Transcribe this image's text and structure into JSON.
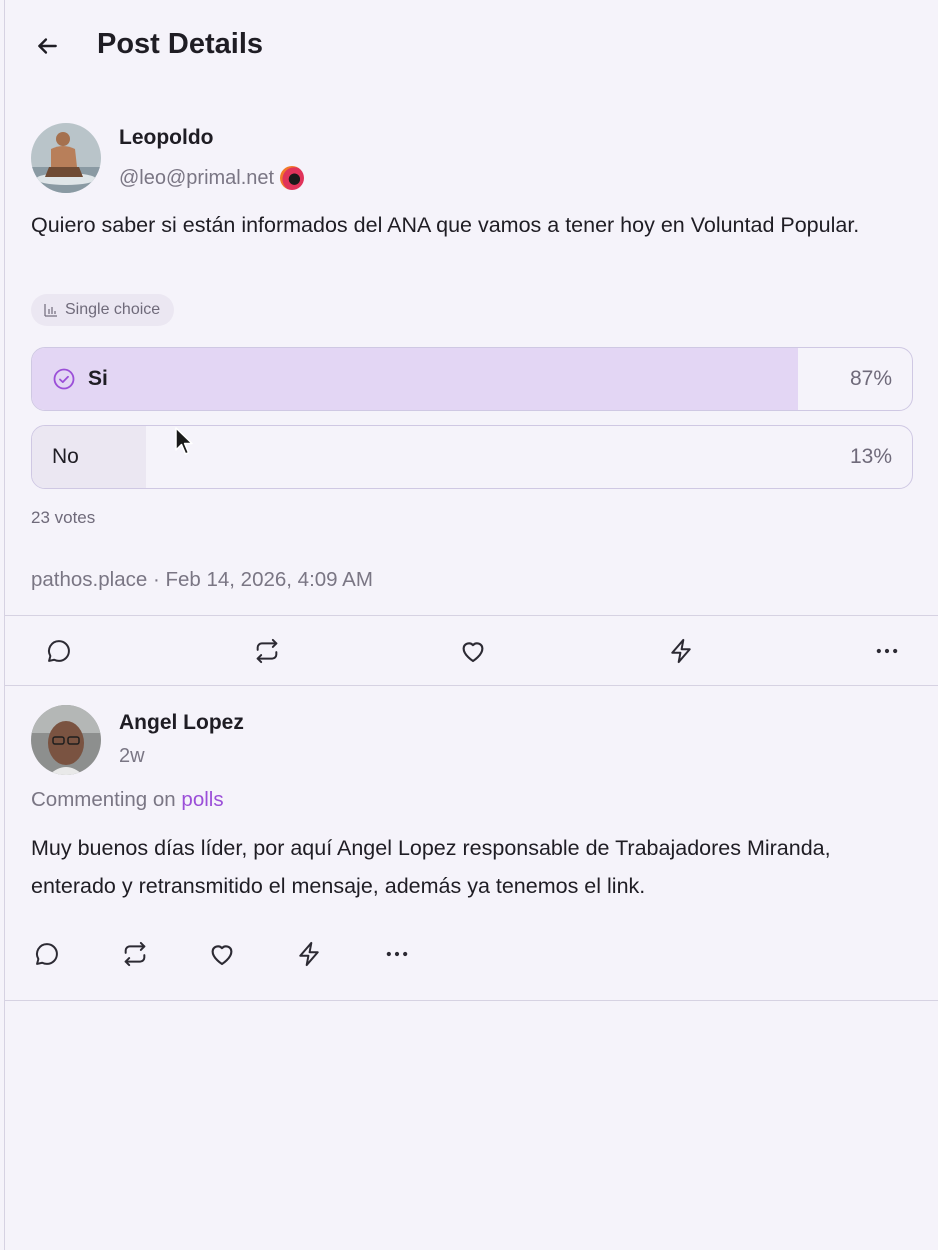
{
  "header": {
    "title": "Post Details"
  },
  "post": {
    "author": {
      "name": "Leopoldo",
      "handle": "@leo@primal.net"
    },
    "text": "Quiero saber si están informados del ANA que vamos a tener hoy en Voluntad Popular.",
    "poll": {
      "type_label": "Single choice",
      "options": [
        {
          "label": "Si",
          "percent_text": "87%",
          "percent": 87,
          "selected": true
        },
        {
          "label": "No",
          "percent_text": "13%",
          "percent": 13,
          "selected": false
        }
      ],
      "votes_label": "23 votes"
    },
    "meta": "pathos.place · Feb 14, 2026, 4:09 AM",
    "actions": [
      "reply",
      "repost",
      "like",
      "zap",
      "more"
    ]
  },
  "reply": {
    "author": {
      "name": "Angel Lopez",
      "time": "2w"
    },
    "commenting_prefix": "Commenting on",
    "commenting_link": "polls",
    "text": "Muy buenos días líder, por aquí Angel Lopez responsable de Trabajadores Miranda, enterado y retransmitido el mensaje, además ya tenemos el link.",
    "actions": [
      "reply",
      "repost",
      "like",
      "zap",
      "more"
    ]
  },
  "colors": {
    "accent": "#9b4fd8",
    "selected_fill": "#e3d6f4",
    "border": "#cfc8e3",
    "background": "#f5f3fa"
  }
}
